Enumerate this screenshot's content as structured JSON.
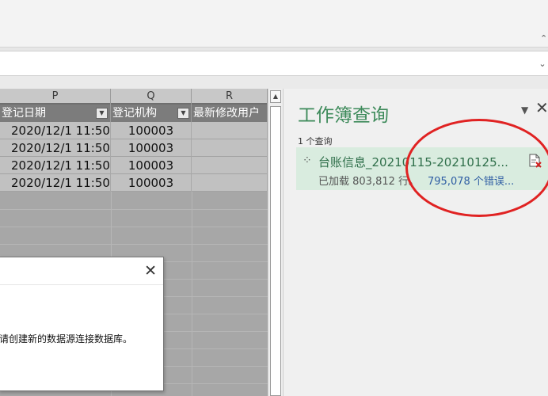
{
  "ribbon": {
    "collapse_icon": "chevron-up-icon"
  },
  "formula_bar": {
    "dropdown_icon": "chevron-down-icon"
  },
  "sheet": {
    "column_letters": [
      "P",
      "Q",
      "R"
    ],
    "table_headers": [
      "登记日期",
      "登记机构",
      "最新修改用户"
    ],
    "rows": [
      [
        "2020/12/1 11:50",
        "100003",
        ""
      ],
      [
        "2020/12/1 11:50",
        "100003",
        ""
      ],
      [
        "2020/12/1 11:50",
        "100003",
        ""
      ],
      [
        "2020/12/1 11:50",
        "100003",
        ""
      ]
    ]
  },
  "queries_pane": {
    "title": "工作簿查询",
    "options_glyph": "▼",
    "close_glyph": "✕",
    "count_label": "1 个查询",
    "query": {
      "name": "台账信息_20210115-20210125...",
      "status": "已加载 803,812 行。",
      "errors": "795,078 个错误..."
    }
  },
  "dialog": {
    "close_glyph": "✕",
    "message": "请创建新的数据源连接数据库。"
  },
  "annotation": {
    "color": "#e02222"
  }
}
